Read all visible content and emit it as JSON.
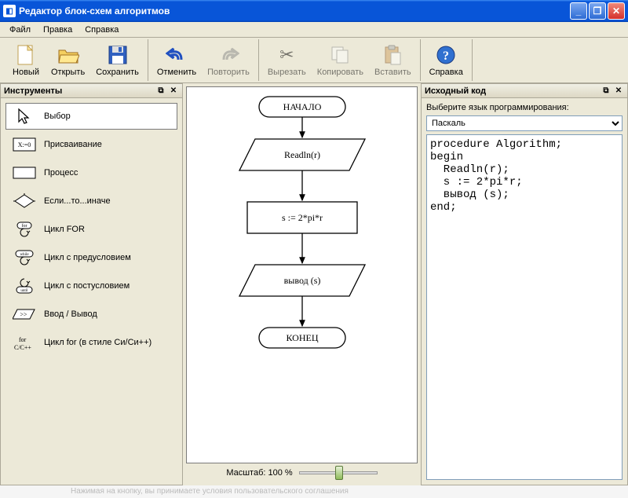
{
  "window": {
    "title": "Редактор блок-схем алгоритмов"
  },
  "menubar": {
    "file": "Файл",
    "edit": "Правка",
    "help": "Справка"
  },
  "toolbar": {
    "new": "Новый",
    "open": "Открыть",
    "save": "Сохранить",
    "undo": "Отменить",
    "redo": "Повторить",
    "cut": "Вырезать",
    "copy": "Копировать",
    "paste": "Вставить",
    "helpbtn": "Справка"
  },
  "left": {
    "title": "Инструменты",
    "items": [
      {
        "label": "Выбор"
      },
      {
        "label": "Присваивание"
      },
      {
        "label": "Процесс"
      },
      {
        "label": "Если...то...иначе"
      },
      {
        "label": "Цикл FOR"
      },
      {
        "label": "Цикл с предусловием"
      },
      {
        "label": "Цикл с постусловием"
      },
      {
        "label": "Ввод / Вывод"
      },
      {
        "label": "Цикл for (в стиле Си/Си++)"
      }
    ]
  },
  "canvas": {
    "zoom_label": "Масштаб: 100 %",
    "nodes": {
      "start": "НАЧАЛО",
      "read": "Readln(r)",
      "assign": "s := 2*pi*r",
      "output": "вывод (s)",
      "end": "КОНЕЦ"
    }
  },
  "right": {
    "title": "Исходный код",
    "lang_prompt": "Выберите язык программирования:",
    "lang_selected": "Паскаль",
    "code": "procedure Algorithm;\nbegin\n  Readln(r);\n  s := 2*pi*r;\n  вывод (s);\nend;"
  },
  "footer": "Нажимая на кнопку, вы принимаете условия пользовательского соглашения"
}
